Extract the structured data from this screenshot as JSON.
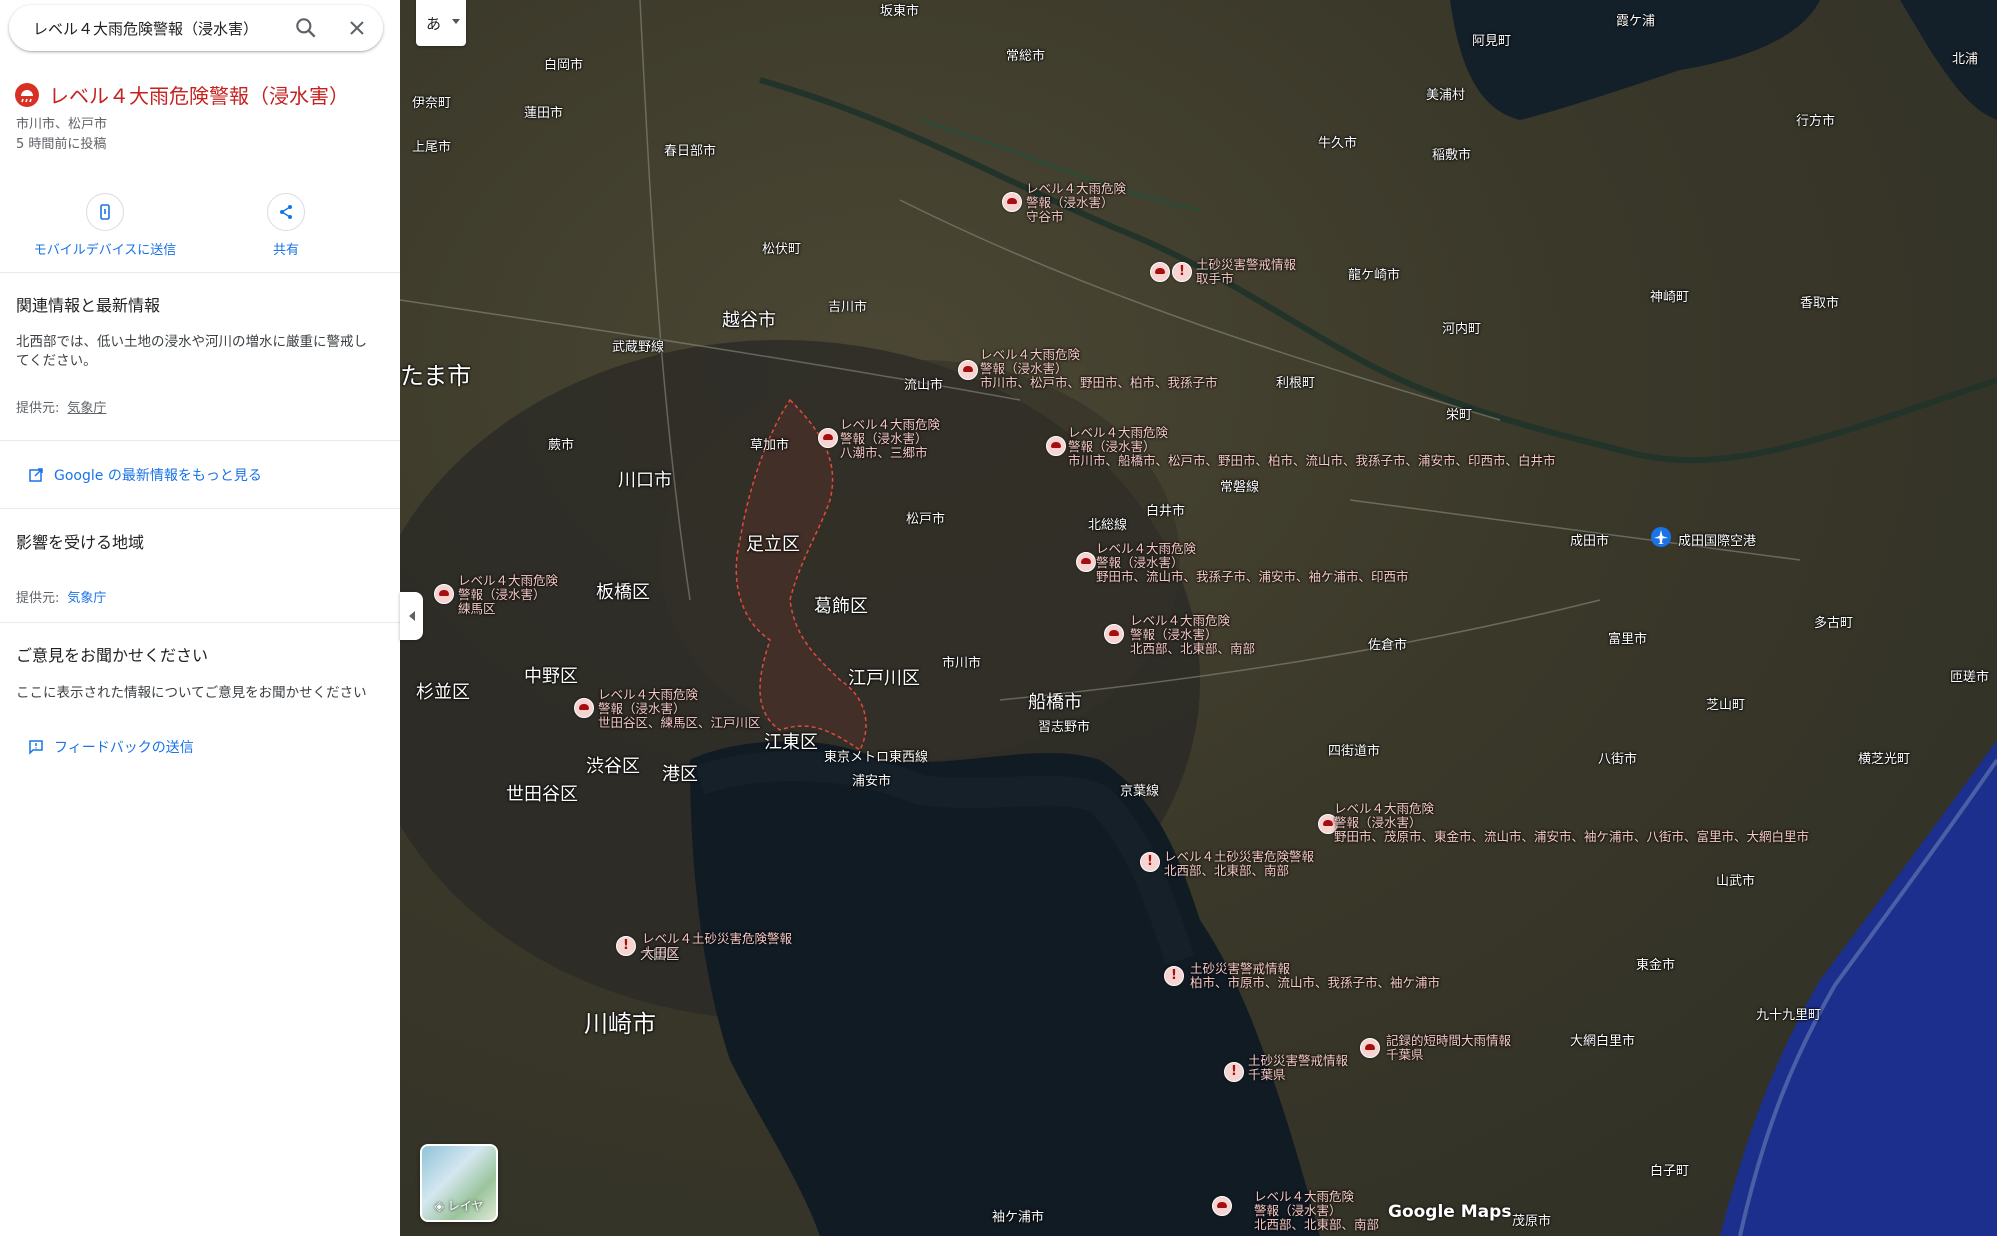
{
  "search": {
    "query": "レベル４大雨危険警報（浸水害）"
  },
  "alert": {
    "title": "レベル４大雨危険警報（浸水害）",
    "areas": "市川市、松戸市",
    "posted": "5 時間前に投稿"
  },
  "actions": {
    "send_to_mobile": "モバイルデバイスに送信",
    "share": "共有"
  },
  "related": {
    "title": "関連情報と最新情報",
    "body": "北西部では、低い土地の浸水や河川の増水に厳重に警戒してください。",
    "provider_label": "提供元:",
    "provider": "気象庁"
  },
  "more_link": "Google の最新情報をもっと見る",
  "affected": {
    "title": "影響を受ける地域",
    "provider_label": "提供元:",
    "provider": "気象庁"
  },
  "feedback": {
    "title": "ご意見をお聞かせください",
    "body": "ここに表示された情報についてご意見をお聞かせください",
    "button": "フィードバックの送信"
  },
  "map": {
    "ime": "あ",
    "layers": "レイヤ",
    "brand": "Google Maps",
    "places": [
      {
        "n": "坂東市"
      },
      {
        "n": "常総市"
      },
      {
        "n": "白岡市"
      },
      {
        "n": "伊奈町"
      },
      {
        "n": "蓮田市"
      },
      {
        "n": "上尾市"
      },
      {
        "n": "春日部市"
      },
      {
        "n": "松伏町"
      },
      {
        "n": "吉川市"
      },
      {
        "n": "越谷市"
      },
      {
        "n": "流山市"
      },
      {
        "n": "たま市"
      },
      {
        "n": "蕨市"
      },
      {
        "n": "川口市"
      },
      {
        "n": "草加市"
      },
      {
        "n": "足立区"
      },
      {
        "n": "板橋区"
      },
      {
        "n": "葛飾区"
      },
      {
        "n": "松戸市"
      },
      {
        "n": "市川市"
      },
      {
        "n": "江戸川区"
      },
      {
        "n": "杉並区"
      },
      {
        "n": "中野区"
      },
      {
        "n": "江東区"
      },
      {
        "n": "渋谷区"
      },
      {
        "n": "港区"
      },
      {
        "n": "世田谷区"
      },
      {
        "n": "浦安市"
      },
      {
        "n": "船橋市"
      },
      {
        "n": "習志野市"
      },
      {
        "n": "白井市"
      },
      {
        "n": "利根町"
      },
      {
        "n": "龍ケ崎市"
      },
      {
        "n": "河内町"
      },
      {
        "n": "牛久市"
      },
      {
        "n": "稲敷市"
      },
      {
        "n": "美浦村"
      },
      {
        "n": "阿見町"
      },
      {
        "n": "行方市"
      },
      {
        "n": "神崎町"
      },
      {
        "n": "香取市"
      },
      {
        "n": "栄町"
      },
      {
        "n": "成田市"
      },
      {
        "n": "成田国際空港"
      },
      {
        "n": "佐倉市"
      },
      {
        "n": "富里市"
      },
      {
        "n": "多古町"
      },
      {
        "n": "八街市"
      },
      {
        "n": "芝山町"
      },
      {
        "n": "横芝光町"
      },
      {
        "n": "匝瑳市"
      },
      {
        "n": "四街道市"
      },
      {
        "n": "山武市"
      },
      {
        "n": "東金市"
      },
      {
        "n": "大網白里市"
      },
      {
        "n": "九十九里町"
      },
      {
        "n": "白子町"
      },
      {
        "n": "茂原市"
      },
      {
        "n": "袖ケ浦市"
      },
      {
        "n": "川崎市"
      },
      {
        "n": "大田区"
      },
      {
        "n": "北総線"
      },
      {
        "n": "常磐線"
      },
      {
        "n": "霞ケ浦"
      },
      {
        "n": "北浦"
      },
      {
        "n": "武蔵野線"
      },
      {
        "n": "京葉線"
      },
      {
        "n": "東京メトロ東西線"
      }
    ],
    "alert_labels": [
      {
        "l1": "レベル４大雨危険",
        "l2": "警報（浸水害）",
        "l3": "守谷市"
      },
      {
        "l1": "土砂災害警戒情報",
        "l2": "取手市",
        "l3": ""
      },
      {
        "l1": "レベル４大雨危険",
        "l2": "警報（浸水害）",
        "l3": "市川市、松戸市、野田市、柏市、我孫子市"
      },
      {
        "l1": "レベル４大雨危険",
        "l2": "警報（浸水害）",
        "l3": "八潮市、三郷市"
      },
      {
        "l1": "レベル４大雨危険",
        "l2": "警報（浸水害）",
        "l3": "市川市、船橋市、松戸市、野田市、柏市、流山市、我孫子市、浦安市、印西市、白井市"
      },
      {
        "l1": "レベル４大雨危険",
        "l2": "警報（浸水害）",
        "l3": "野田市、流山市、我孫子市、浦安市、袖ケ浦市、印西市"
      },
      {
        "l1": "レベル４大雨危険",
        "l2": "警報（浸水害）",
        "l3": "練馬区"
      },
      {
        "l1": "レベル４大雨危険",
        "l2": "警報（浸水害）",
        "l3": "北西部、北東部、南部"
      },
      {
        "l1": "レベル４大雨危険",
        "l2": "警報（浸水害）",
        "l3": "世田谷区、練馬区、江戸川区"
      },
      {
        "l1": "レベル４大雨危険",
        "l2": "警報（浸水害）",
        "l3": "野田市、茂原市、東金市、流山市、浦安市、袖ケ浦市、八街市、富里市、大網白里市"
      },
      {
        "l1": "レベル４土砂災害危険警報",
        "l2": "北西部、北東部、南部",
        "l3": ""
      },
      {
        "l1": "レベル４土砂災害危険警報",
        "l2": "大田区",
        "l3": ""
      },
      {
        "l1": "土砂災害警戒情報",
        "l2": "柏市、市原市、流山市、我孫子市、袖ケ浦市",
        "l3": ""
      },
      {
        "l1": "記録的短時間大雨情報",
        "l2": "千葉県",
        "l3": ""
      },
      {
        "l1": "土砂災害警戒情報",
        "l2": "千葉県",
        "l3": ""
      },
      {
        "l1": "レベル４大雨危険",
        "l2": "警報（浸水害）",
        "l3": "北西部、北東部、南部"
      }
    ]
  }
}
